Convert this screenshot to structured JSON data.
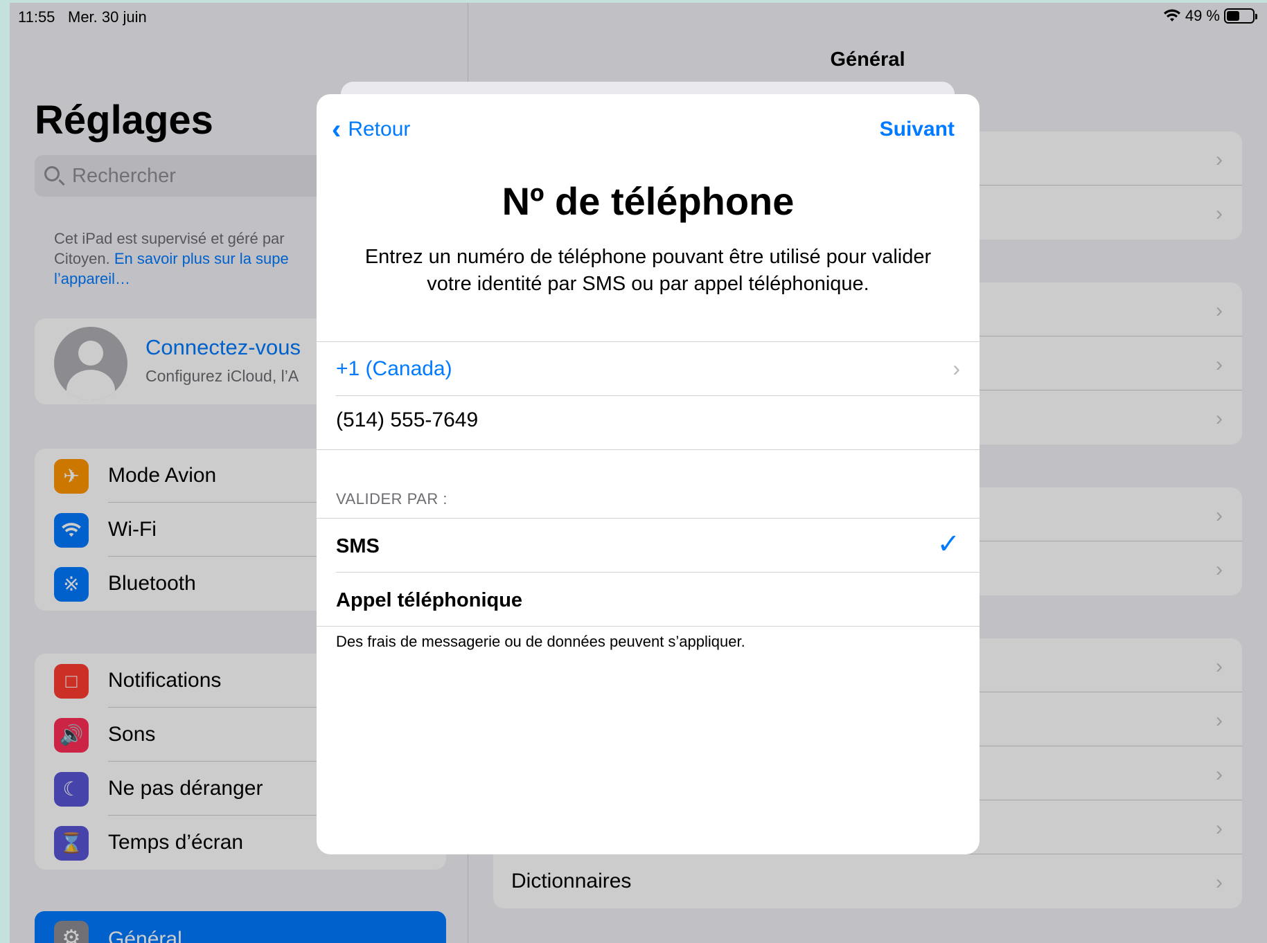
{
  "status_bar": {
    "time": "11:55",
    "date": "Mer. 30 juin",
    "battery": "49 %",
    "battery_level": 0.49
  },
  "sidebar": {
    "title": "Réglages",
    "search_placeholder": "Rechercher",
    "supervision_text": "Cet iPad est supervisé et géré par",
    "supervision_text2": "Citoyen.",
    "supervision_link": "En savoir plus sur la supe",
    "supervision_link2": "l’appareil…",
    "account_name": "Connectez-vous",
    "account_sub": "Configurez iCloud, l’A",
    "group1": [
      {
        "label": "Mode Avion",
        "icon": "airplane-icon",
        "color": "#ff9500"
      },
      {
        "label": "Wi-Fi",
        "icon": "wifi-icon",
        "color": "#007aff"
      },
      {
        "label": "Bluetooth",
        "icon": "bluetooth-icon",
        "color": "#007aff"
      }
    ],
    "group2": [
      {
        "label": "Notifications",
        "icon": "notifications-icon",
        "color": "#ff3b30"
      },
      {
        "label": "Sons",
        "icon": "sounds-icon",
        "color": "#ff2d55"
      },
      {
        "label": "Ne pas déranger",
        "icon": "moon-icon",
        "color": "#5856d6"
      },
      {
        "label": "Temps d’écran",
        "icon": "hourglass-icon",
        "color": "#5856d6"
      }
    ],
    "selected": {
      "label": "Général",
      "icon": "gear-icon"
    }
  },
  "detail": {
    "title": "Général",
    "last_row": "Dictionnaires"
  },
  "modal": {
    "back_label": "Retour",
    "next_label": "Suivant",
    "title": "Nº de téléphone",
    "description": "Entrez un numéro de téléphone pouvant être utilisé pour valider votre identité par SMS ou par appel téléphonique.",
    "country": "+1 (Canada)",
    "phone_value": "(514) 555-7649",
    "validate_header": "VALIDER PAR :",
    "options": [
      {
        "label": "SMS",
        "selected": true
      },
      {
        "label": "Appel téléphonique",
        "selected": false
      }
    ],
    "footer": "Des frais de messagerie ou de données peuvent s’appliquer."
  }
}
